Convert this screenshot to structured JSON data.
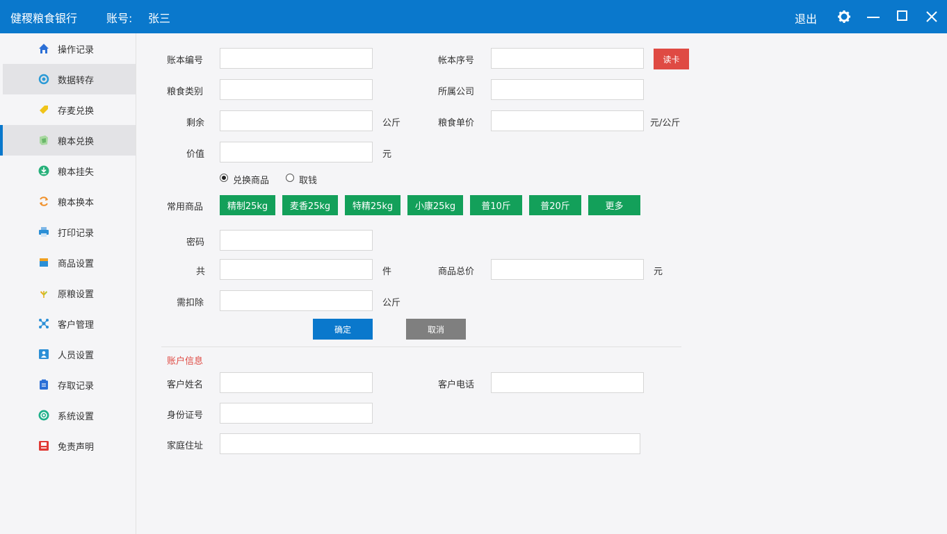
{
  "titlebar": {
    "app_title": "健稷粮食银行",
    "account_label": "账号:",
    "account_name": "张三",
    "logout": "退出"
  },
  "sidebar": {
    "items": [
      {
        "label": "操作记录",
        "icon": "home-icon",
        "color": "#2b6fd6"
      },
      {
        "label": "数据转存",
        "icon": "transfer-icon",
        "color": "#2b9ad6"
      },
      {
        "label": "存麦兑换",
        "icon": "tag-icon",
        "color": "#f0c419"
      },
      {
        "label": "粮本兑换",
        "icon": "book-exchange-icon",
        "color": "#6ab86a"
      },
      {
        "label": "粮本挂失",
        "icon": "download-icon",
        "color": "#27b07a"
      },
      {
        "label": "粮本换本",
        "icon": "refresh-icon",
        "color": "#f0902a"
      },
      {
        "label": "打印记录",
        "icon": "printer-icon",
        "color": "#2b8fd6"
      },
      {
        "label": "商品设置",
        "icon": "box-icon",
        "color": "#2b8fd6"
      },
      {
        "label": "原粮设置",
        "icon": "grain-icon",
        "color": "#e8b020"
      },
      {
        "label": "客户管理",
        "icon": "network-icon",
        "color": "#2b8fd6"
      },
      {
        "label": "人员设置",
        "icon": "user-card-icon",
        "color": "#2b8fd6"
      },
      {
        "label": "存取记录",
        "icon": "clipboard-icon",
        "color": "#2b6fd6"
      },
      {
        "label": "系统设置",
        "icon": "settings-icon",
        "color": "#1fb08a"
      },
      {
        "label": "免责声明",
        "icon": "notice-icon",
        "color": "#e03a35"
      }
    ]
  },
  "form": {
    "account_no_label": "账本编号",
    "account_seq_label": "帐本序号",
    "read_card": "读卡",
    "grain_type_label": "粮食类别",
    "company_label": "所属公司",
    "remaining_label": "剩余",
    "remaining_unit": "公斤",
    "unit_price_label": "粮食单价",
    "unit_price_unit": "元/公斤",
    "value_label": "价值",
    "value_unit": "元",
    "radio_goods": "兑换商品",
    "radio_cash": "取钱",
    "common_goods_label": "常用商品",
    "goods": [
      "精制25kg",
      "麦香25kg",
      "特精25kg",
      "小康25kg",
      "普10斤",
      "普20斤",
      "更多"
    ],
    "password_label": "密码",
    "total_count_label": "共",
    "total_count_unit": "件",
    "goods_total_label": "商品总价",
    "goods_total_unit": "元",
    "deduct_label": "需扣除",
    "deduct_unit": "公斤",
    "confirm": "确定",
    "cancel": "取消"
  },
  "account_info": {
    "title": "账户信息",
    "name_label": "客户姓名",
    "phone_label": "客户电话",
    "id_label": "身份证号",
    "address_label": "家庭住址"
  }
}
